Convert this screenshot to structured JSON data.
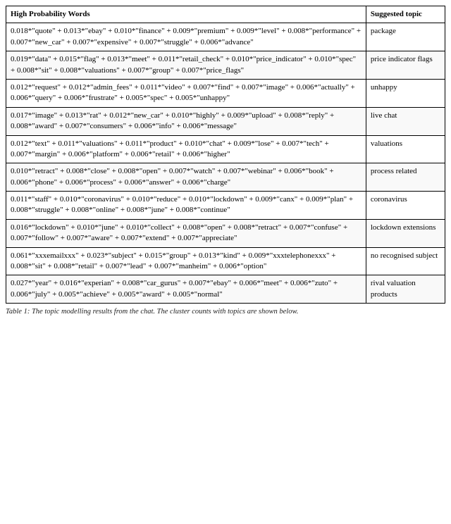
{
  "table": {
    "headers": {
      "words": "High Probability Words",
      "topic": "Suggested topic"
    },
    "rows": [
      {
        "words": "0.018*\"quote\" + 0.013*\"ebay\" + 0.010*\"finance\" + 0.009*\"premium\" + 0.009*\"level\" + 0.008*\"performance\" + 0.007*\"new_car\" + 0.007*\"expensive\" + 0.007*\"struggle\" + 0.006*\"advance\"",
        "topic": "package"
      },
      {
        "words": "0.019*\"data\" + 0.015*\"flag\" + 0.013*\"meet\" + 0.011*\"retail_check\" + 0.010*\"price_indicator\" + 0.010*\"spec\" + 0.008*\"sit\" + 0.008*\"valuations\" + 0.007*\"group\" + 0.007*\"price_flags\"",
        "topic": "price indicator flags"
      },
      {
        "words": "0.012*\"request\" + 0.012*\"admin_fees\" + 0.011*\"video\" + 0.007*\"find\" + 0.007*\"image\" + 0.006*\"actually\" + 0.006*\"query\" + 0.006*\"frustrate\" + 0.005*\"spec\" + 0.005*\"unhappy\"",
        "topic": "unhappy"
      },
      {
        "words": "0.017*\"image\" + 0.013*\"rat\" + 0.012*\"new_car\" + 0.010*\"highly\" + 0.009*\"upload\" + 0.008*\"reply\" + 0.008*\"award\" + 0.007*\"consumers\" + 0.006*\"info\" + 0.006*\"message\"",
        "topic": "live chat"
      },
      {
        "words": "0.012*\"text\" + 0.011*\"valuations\" + 0.011*\"product\" + 0.010*\"chat\" + 0.009*\"lose\" + 0.007*\"tech\" + 0.007*\"margin\" + 0.006*\"platform\" + 0.006*\"retail\" + 0.006*\"higher\"",
        "topic": "valuations"
      },
      {
        "words": "0.010*\"retract\" + 0.008*\"close\" + 0.008*\"open\" + 0.007*\"watch\" + 0.007*\"webinar\" + 0.006*\"book\" + 0.006*\"phone\" + 0.006*\"process\" + 0.006*\"answer\" + 0.006*\"charge\"",
        "topic": "process related"
      },
      {
        "words": "0.011*\"staff\" + 0.010*\"coronavirus\" + 0.010*\"reduce\" + 0.010*\"lockdown\" + 0.009*\"canx\" + 0.009*\"plan\" + 0.008*\"struggle\" + 0.008*\"online\" + 0.008*\"june\" + 0.008*\"continue\"",
        "topic": "coronavirus"
      },
      {
        "words": "0.016*\"lockdown\" + 0.010*\"june\" + 0.010*\"collect\" + 0.008*\"open\" + 0.008*\"retract\" + 0.007*\"confuse\" + 0.007*\"follow\" + 0.007*\"aware\" + 0.007*\"extend\" + 0.007*\"appreciate\"",
        "topic": "lockdown extensions"
      },
      {
        "words": "0.061*\"xxxemailxxx\" + 0.023*\"subject\" + 0.015*\"group\" + 0.013*\"kind\" + 0.009*\"xxxtelephonexxx\" + 0.008*\"sit\" + 0.008*\"retail\" + 0.007*\"lead\" + 0.007*\"manheim\" + 0.006*\"option\"",
        "topic": "no recognised subject"
      },
      {
        "words": "0.027*\"year\" + 0.016*\"experian\" + 0.008*\"car_gurus\" + 0.007*\"ebay\" + 0.006*\"meet\" + 0.006*\"zuto\" + 0.006*\"july\" + 0.005*\"achieve\" + 0.005*\"award\" + 0.005*\"normal\"",
        "topic": "rival valuation products"
      }
    ],
    "caption": "Table 1: The topic modelling results from the chat. The cluster counts with topics are shown below."
  }
}
